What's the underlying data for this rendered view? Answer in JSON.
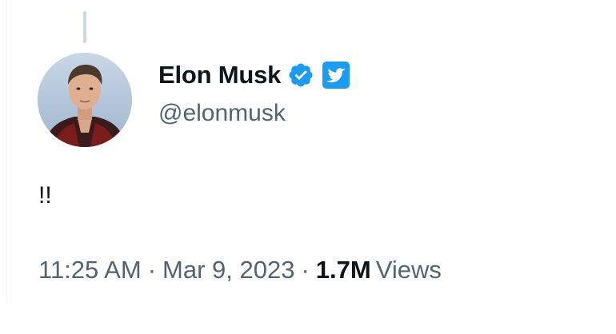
{
  "author": {
    "display_name": "Elon Musk",
    "handle": "@elonmusk",
    "verified": true,
    "verified_color": "#1d9bf0",
    "avatar_icon": "profile-photo"
  },
  "tweet": {
    "text": "!!",
    "time": "11:25 AM",
    "separator": "·",
    "date": "Mar 9, 2023",
    "views_count": "1.7M",
    "views_label": "Views"
  },
  "colors": {
    "primary_text": "#0f1419",
    "secondary_text": "#536471",
    "accent": "#1d9bf0"
  }
}
